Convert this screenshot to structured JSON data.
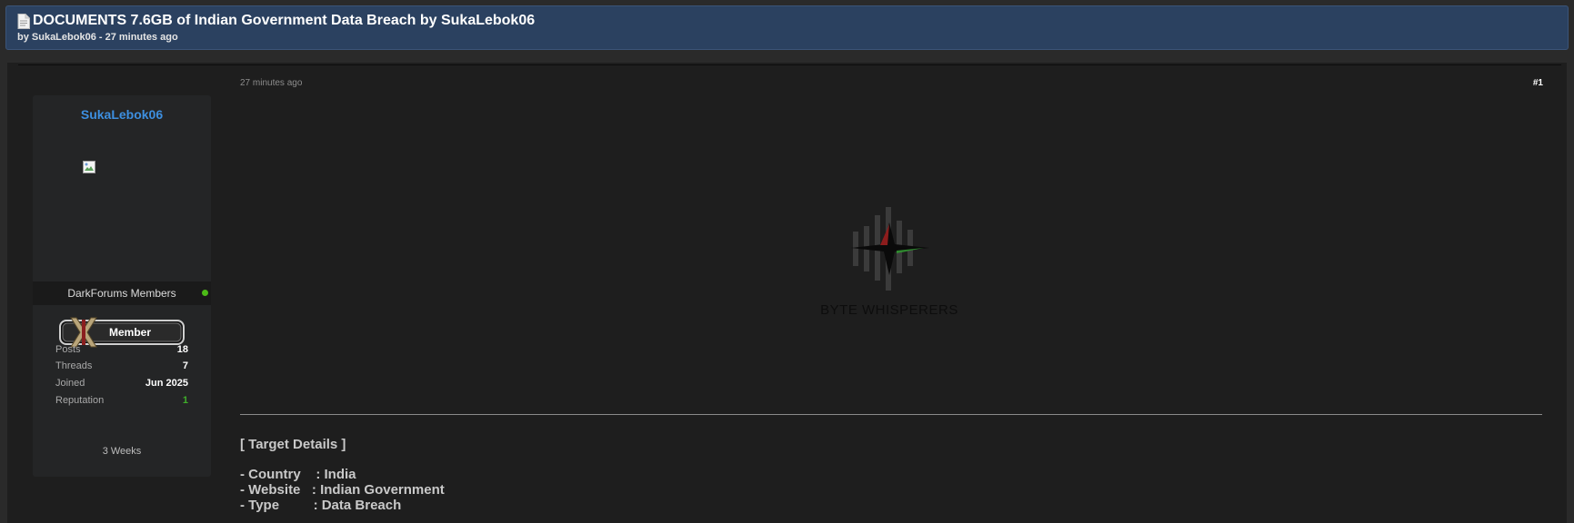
{
  "thread": {
    "title": "DOCUMENTS 7.6GB of Indian Government Data Breach by SukaLebok06",
    "subtitle": "by SukaLebok06 - 27 minutes ago"
  },
  "author": {
    "name": "SukaLebok06",
    "group": "DarkForums Members",
    "rank_badge": "Member",
    "stats": [
      {
        "label": "Posts",
        "value": "18"
      },
      {
        "label": "Threads",
        "value": "7"
      },
      {
        "label": "Joined",
        "value": "Jun 2025"
      },
      {
        "label": "Reputation",
        "value": "1"
      }
    ],
    "stat_note": "3 Weeks"
  },
  "post": {
    "time": "27 minutes ago",
    "number": "#1",
    "logo_text": "BYTE WHISPERERS",
    "heading": "[ Target Details ]",
    "details": [
      "- Country    : India",
      "- Website   : Indian Government",
      "- Type         : Data Breach"
    ]
  },
  "colors": {
    "header_bg": "#2b4160",
    "author_link": "#3d8fe0",
    "online": "#4cbb17",
    "reputation": "#3fae2a"
  }
}
